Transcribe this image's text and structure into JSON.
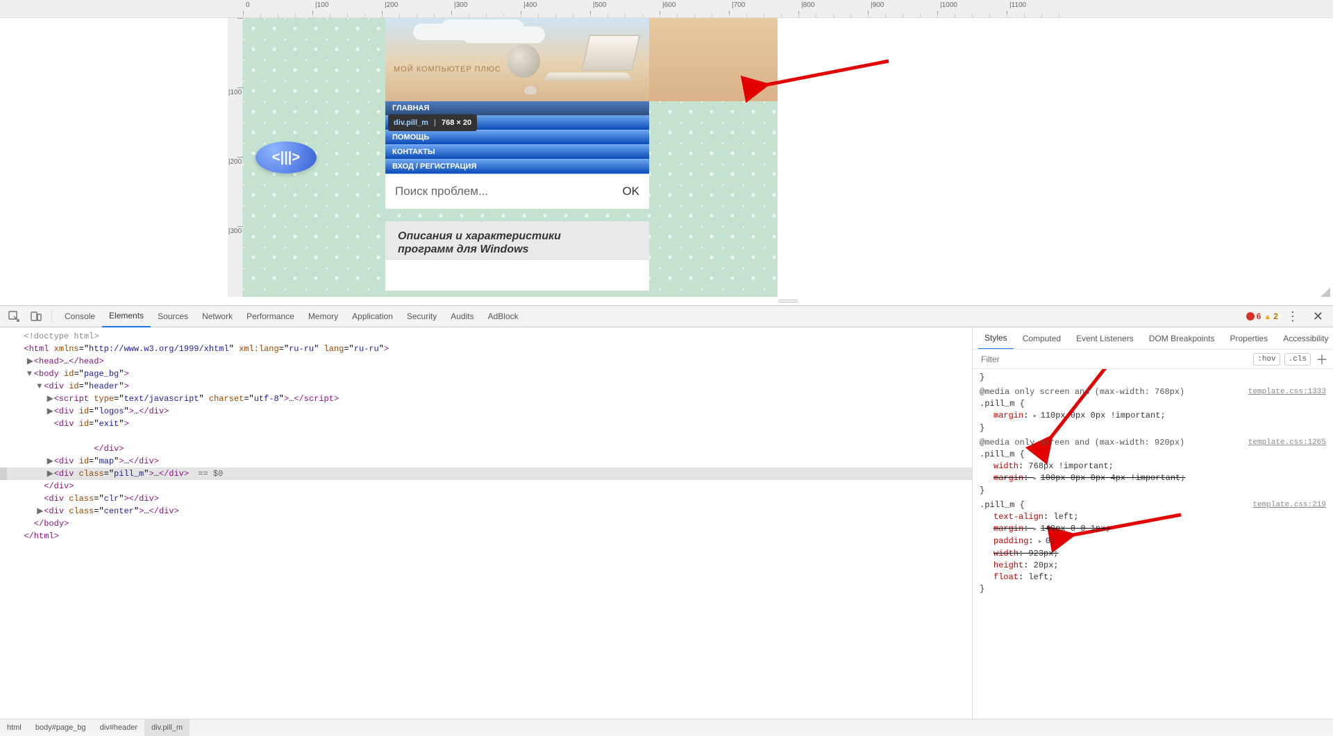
{
  "ruler_h": [
    "0",
    "|100",
    "|200",
    "|300",
    "|400",
    "|500",
    "|600",
    "|700",
    "|800",
    "|900",
    "|1000",
    "|1100"
  ],
  "ruler_v": [
    " ",
    "|100",
    "|200",
    "|300"
  ],
  "site": {
    "logo_text": "МОЙ КОМПЬЮТЕР ПЛЮС",
    "nav": [
      "ГЛАВНАЯ",
      "",
      "ПОМОЩЬ",
      "КОНТАКТЫ",
      "ВХОД / РЕГИСТРАЦИЯ"
    ],
    "tooltip_sel": "div.pill_m",
    "tooltip_dim": "768 × 20",
    "search_placeholder": "Поиск проблем...",
    "search_ok": "OK",
    "content_title_l1": "Описания и характеристики",
    "content_title_l2": "программ для Windows",
    "pill_badge": "<|||>"
  },
  "devtools": {
    "tabs": [
      "Console",
      "Elements",
      "Sources",
      "Network",
      "Performance",
      "Memory",
      "Application",
      "Security",
      "Audits",
      "AdBlock"
    ],
    "active_tab": "Elements",
    "errors": 6,
    "warnings": 2,
    "styles_tabs": [
      "Styles",
      "Computed",
      "Event Listeners",
      "DOM Breakpoints",
      "Properties",
      "Accessibility"
    ],
    "styles_active": "Styles",
    "filter_placeholder": "Filter",
    "hov": ":hov",
    "cls": ".cls",
    "dom": {
      "doctype": "<!doctype html>",
      "html_attrs": {
        "xmlns": "http://www.w3.org/1999/xhtml",
        "xml_lang": "ru-ru",
        "lang": "ru-ru"
      },
      "body_id": "page_bg",
      "header_id": "header",
      "script_type": "text/javascript",
      "script_charset": "utf-8",
      "logos_id": "logos",
      "exit_id": "exit",
      "map_id": "map",
      "pill_class": "pill_m",
      "clr_class": "clr",
      "center_class": "center",
      "eq_zero": " == $0"
    },
    "rules": [
      {
        "media": "@media only screen and (max-width: 768px)",
        "selector": ".pill_m",
        "src": "template.css:1333",
        "lines": [
          {
            "prop": "margin",
            "val": "110px 0px 0px !important;",
            "tri": true
          }
        ]
      },
      {
        "media": "@media only screen and (max-width: 920px)",
        "selector": ".pill_m",
        "src": "template.css:1265",
        "lines": [
          {
            "prop": "width",
            "val": "768px !important;"
          },
          {
            "prop": "margin",
            "val": "100px 0px 0px 4px !important;",
            "strike": true,
            "tri": true
          }
        ]
      },
      {
        "selector": ".pill_m",
        "src": "template.css:219",
        "lines": [
          {
            "prop": "text-align",
            "val": "left;"
          },
          {
            "prop": "margin",
            "val": "149px 0 0 1px;",
            "strike": true,
            "tri": true
          },
          {
            "prop": "padding",
            "val": "0;",
            "tri": true
          },
          {
            "prop": "width",
            "val": "923px;",
            "strike": true
          },
          {
            "prop": "height",
            "val": "20px;"
          },
          {
            "prop": "float",
            "val": "left;"
          }
        ]
      }
    ],
    "crumbs": [
      "html",
      "body#page_bg",
      "div#header",
      "div.pill_m"
    ]
  }
}
